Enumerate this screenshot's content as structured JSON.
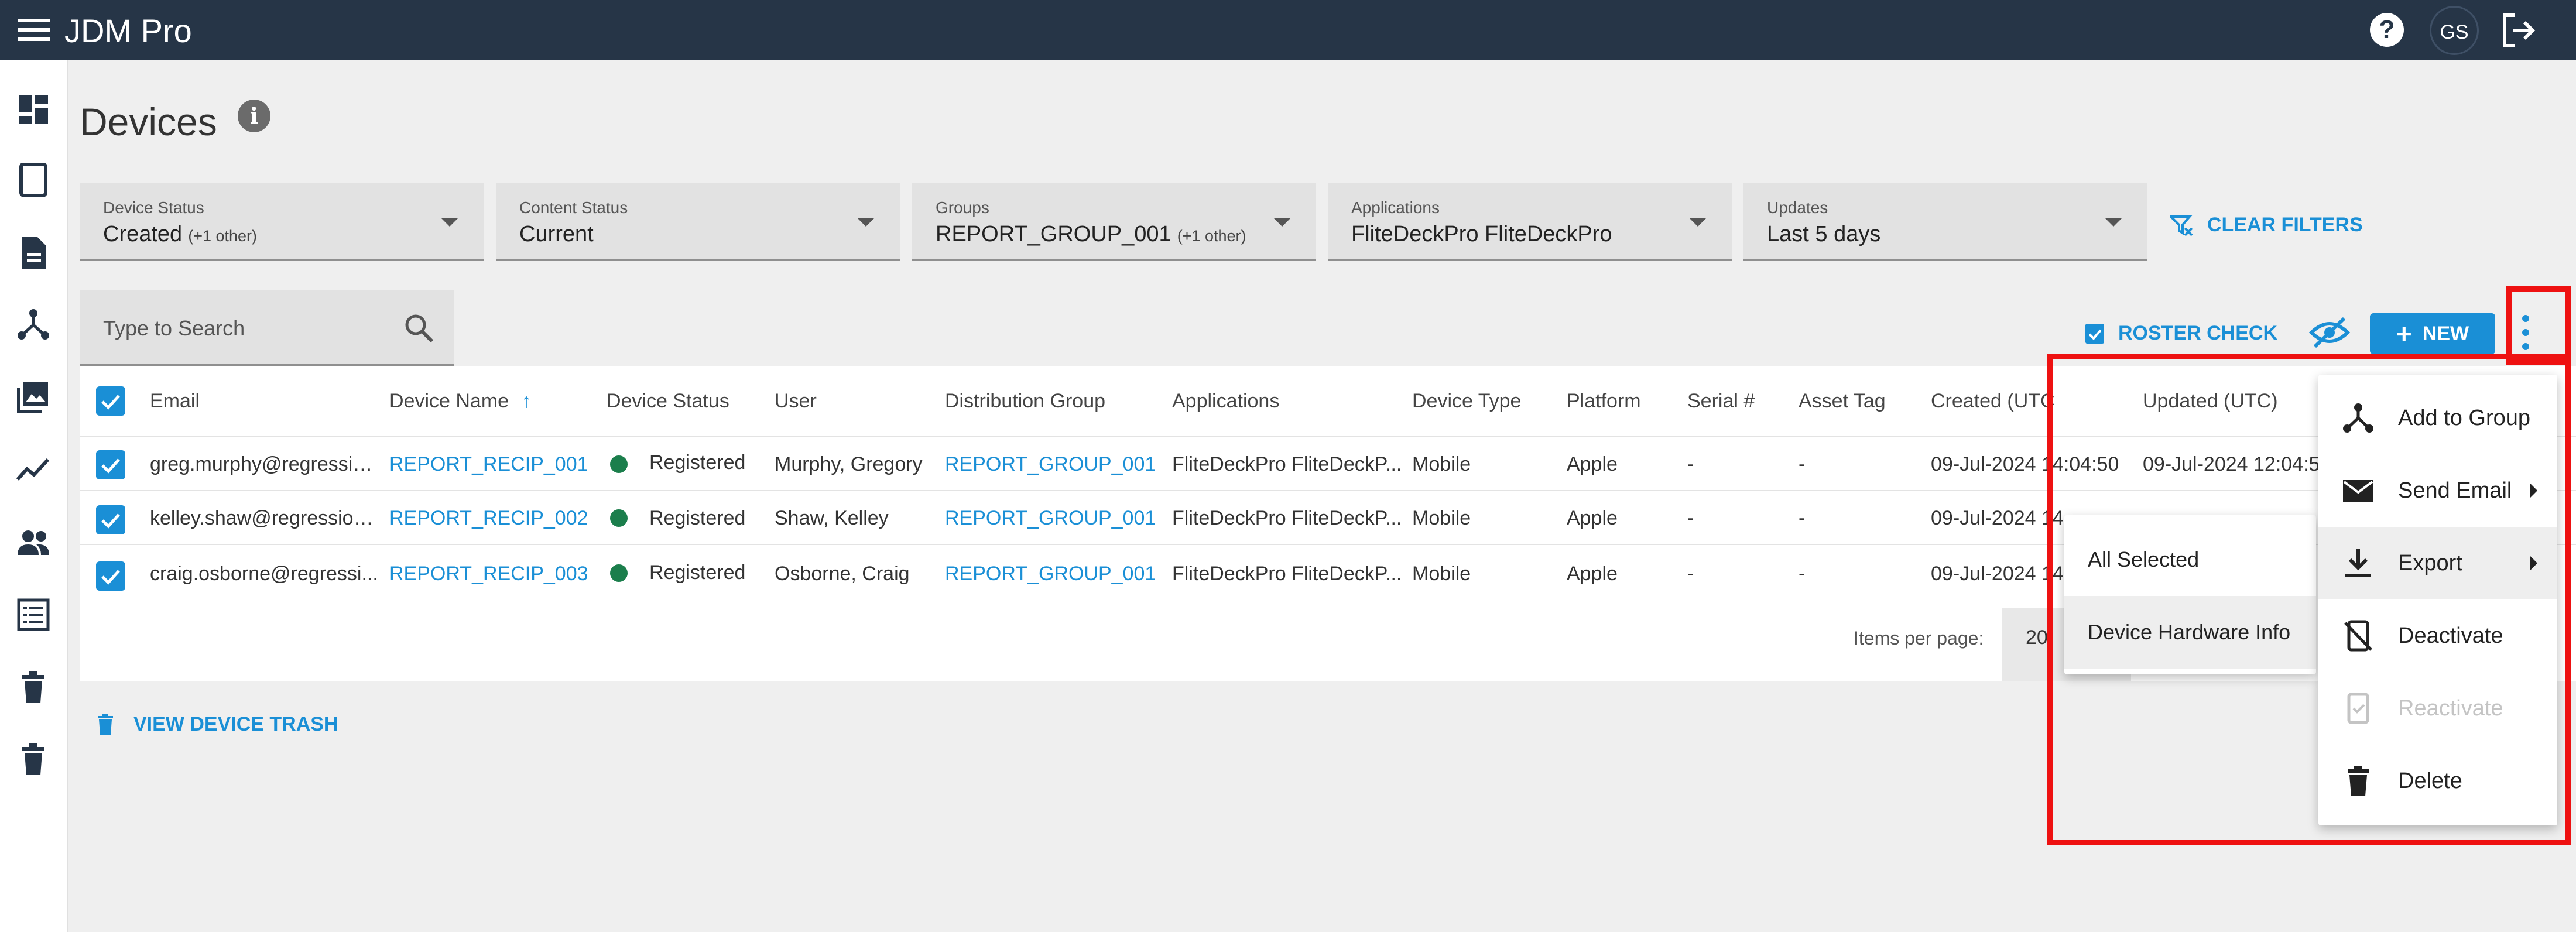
{
  "app": {
    "title": "JDM Pro",
    "avatar_initials": "GS"
  },
  "page": {
    "title": "Devices"
  },
  "filters": [
    {
      "label": "Device Status",
      "value": "Created",
      "note": "(+1 other)"
    },
    {
      "label": "Content Status",
      "value": "Current",
      "note": ""
    },
    {
      "label": "Groups",
      "value": "REPORT_GROUP_001",
      "note": "(+1 other)"
    },
    {
      "label": "Applications",
      "value": "FliteDeckPro FliteDeckPro",
      "note": ""
    },
    {
      "label": "Updates",
      "value": "Last 5 days",
      "note": ""
    }
  ],
  "clear_filters_label": "CLEAR FILTERS",
  "search": {
    "placeholder": "Type to Search"
  },
  "actions": {
    "roster_check": "ROSTER CHECK",
    "new_label": "NEW"
  },
  "table": {
    "headers": [
      "Email",
      "Device Name",
      "Device Status",
      "User",
      "Distribution Group",
      "Applications",
      "Device Type",
      "Platform",
      "Serial #",
      "Asset Tag",
      "Created (UTC",
      "Updated (UTC)"
    ],
    "rows": [
      {
        "email": "greg.murphy@regressio...",
        "device_name": "REPORT_RECIP_001",
        "status": "Registered",
        "user": "Murphy, Gregory",
        "group": "REPORT_GROUP_001",
        "applications": "FliteDeckPro FliteDeckP...",
        "device_type": "Mobile",
        "platform": "Apple",
        "serial": "-",
        "asset_tag": "-",
        "created": "09-Jul-2024 14:04:50",
        "updated": "09-Jul-2024 12:04:5"
      },
      {
        "email": "kelley.shaw@regression....",
        "device_name": "REPORT_RECIP_002",
        "status": "Registered",
        "user": "Shaw, Kelley",
        "group": "REPORT_GROUP_001",
        "applications": "FliteDeckPro FliteDeckP...",
        "device_type": "Mobile",
        "platform": "Apple",
        "serial": "-",
        "asset_tag": "-",
        "created": "09-Jul-2024 14",
        "updated": ""
      },
      {
        "email": "craig.osborne@regressi...",
        "device_name": "REPORT_RECIP_003",
        "status": "Registered",
        "user": "Osborne, Craig",
        "group": "REPORT_GROUP_001",
        "applications": "FliteDeckPro FliteDeckP...",
        "device_type": "Mobile",
        "platform": "Apple",
        "serial": "-",
        "asset_tag": "-",
        "created": "09-Jul-2024 14",
        "updated": ""
      }
    ],
    "items_per_page_label": "Items per page:",
    "page_size": "20"
  },
  "trash_link": "VIEW DEVICE TRASH",
  "more_menu": {
    "items": [
      {
        "label": "Add to Group",
        "icon": "hierarchy-icon"
      },
      {
        "label": "Send Email",
        "icon": "envelope-icon"
      },
      {
        "label": "Export",
        "icon": "download-icon"
      },
      {
        "label": "Deactivate",
        "icon": "device-off-icon"
      },
      {
        "label": "Reactivate",
        "icon": "device-check-icon"
      },
      {
        "label": "Delete",
        "icon": "trash-icon"
      }
    ]
  },
  "export_submenu": {
    "items": [
      "All Selected",
      "Device Hardware Info"
    ]
  },
  "colors": {
    "topbar": "#263547",
    "accent": "#1a8fd6",
    "status_registered": "#1b7e4c",
    "annotation": "#ee1111"
  }
}
